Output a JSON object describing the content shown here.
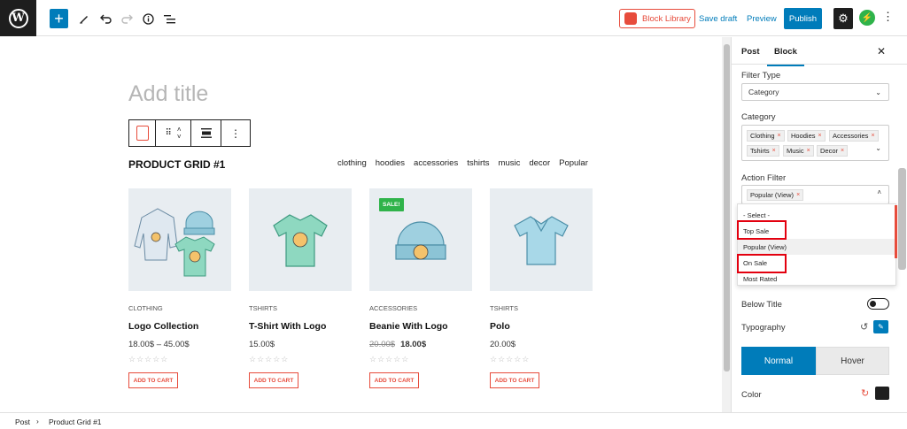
{
  "toolbar": {
    "block_library": "Block Library",
    "save_draft": "Save draft",
    "preview": "Preview",
    "publish": "Publish"
  },
  "editor": {
    "title_placeholder": "Add title",
    "grid_title": "PRODUCT GRID #1",
    "categories": [
      "clothing",
      "hoodies",
      "accessories",
      "tshirts",
      "music",
      "decor",
      "Popular"
    ],
    "products": [
      {
        "category": "CLOTHING",
        "name": "Logo Collection",
        "price": "18.00$ – 45.00$",
        "old_price": "",
        "sale": "",
        "cart": "ADD TO CART"
      },
      {
        "category": "TSHIRTS",
        "name": "T-Shirt With Logo",
        "price": "15.00$",
        "old_price": "",
        "sale": "",
        "cart": "ADD TO CART"
      },
      {
        "category": "ACCESSORIES",
        "name": "Beanie With Logo",
        "price": "18.00$",
        "old_price": "20.00$",
        "sale": "SALE!",
        "cart": "ADD TO CART"
      },
      {
        "category": "TSHIRTS",
        "name": "Polo",
        "price": "20.00$",
        "old_price": "",
        "sale": "",
        "cart": "ADD TO CART"
      }
    ],
    "stars": "☆☆☆☆☆"
  },
  "sidebar": {
    "tabs": [
      "Post",
      "Block"
    ],
    "active_tab": "Block",
    "filter_type_label": "Filter Type",
    "filter_type_value": "Category",
    "category_label": "Category",
    "category_chips": [
      "Clothing",
      "Hoodies",
      "Accessories",
      "Tshirts",
      "Music",
      "Decor"
    ],
    "action_filter_label": "Action Filter",
    "action_filter_chip": "Popular (View)",
    "dropdown_options": [
      "- Select -",
      "Top Sale",
      "Popular (View)",
      "On Sale",
      "Most Rated"
    ],
    "below_title_label": "Below Title",
    "typography_label": "Typography",
    "seg_normal": "Normal",
    "seg_hover": "Hover",
    "color_label": "Color"
  },
  "breadcrumb": {
    "root": "Post",
    "separator": "›",
    "current": "Product Grid #1"
  },
  "colors": {
    "accent": "#007cba",
    "brand_red": "#e74c3c",
    "sale_green": "#2fb34a",
    "highlight_box": "#e3000f"
  }
}
